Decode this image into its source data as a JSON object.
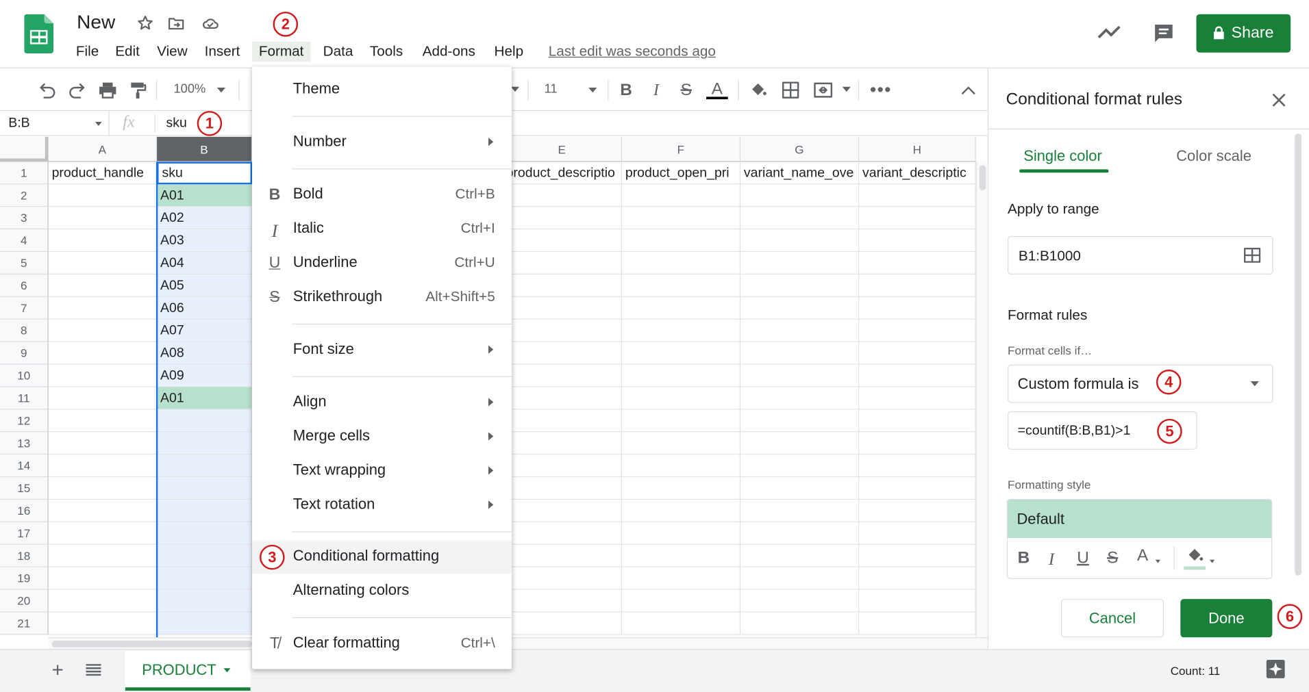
{
  "app": {
    "title": "New",
    "last_edit": "Last edit was seconds ago",
    "share_label": "Share",
    "brand_color": "#188038"
  },
  "menubar": [
    "File",
    "Edit",
    "View",
    "Insert",
    "Format",
    "Data",
    "Tools",
    "Add-ons",
    "Help"
  ],
  "toolbar": {
    "zoom": "100%",
    "font_size": "11"
  },
  "formula_bar": {
    "name_box": "B:B",
    "fx": "fx",
    "content": "sku"
  },
  "grid": {
    "columns": [
      "A",
      "B",
      "E",
      "F",
      "G",
      "H"
    ],
    "row_numbers": [
      "1",
      "2",
      "3",
      "4",
      "5",
      "6",
      "7",
      "8",
      "9",
      "10",
      "11",
      "12",
      "13",
      "14",
      "15",
      "16",
      "17",
      "18",
      "19",
      "20",
      "21"
    ],
    "row1": {
      "A": "product_handle",
      "B": "sku",
      "E": "product_descriptio",
      "F": "product_open_pri",
      "G": "variant_name_ove",
      "H": "variant_descriptic"
    },
    "b_values": [
      "A01",
      "A02",
      "A03",
      "A04",
      "A05",
      "A06",
      "A07",
      "A08",
      "A09",
      "A01"
    ]
  },
  "format_menu": {
    "theme": "Theme",
    "number": "Number",
    "bold": "Bold",
    "bold_sc": "Ctrl+B",
    "italic": "Italic",
    "italic_sc": "Ctrl+I",
    "underline": "Underline",
    "underline_sc": "Ctrl+U",
    "strike": "Strikethrough",
    "strike_sc": "Alt+Shift+5",
    "font_size": "Font size",
    "align": "Align",
    "merge": "Merge cells",
    "wrap": "Text wrapping",
    "rotation": "Text rotation",
    "conditional": "Conditional formatting",
    "alternating": "Alternating colors",
    "clear": "Clear formatting",
    "clear_sc": "Ctrl+\\"
  },
  "panel": {
    "title": "Conditional format rules",
    "tab_single": "Single color",
    "tab_scale": "Color scale",
    "apply_label": "Apply to range",
    "range": "B1:B1000",
    "rules_label": "Format rules",
    "cells_if": "Format cells if…",
    "condition": "Custom formula is",
    "formula": "=countif(B:B,B1)>1",
    "style_label": "Formatting style",
    "style_default": "Default",
    "cancel": "Cancel",
    "done": "Done"
  },
  "badges": [
    "1",
    "2",
    "3",
    "4",
    "5",
    "6"
  ],
  "sheet": {
    "tab": "PRODUCT",
    "count": "Count: 11"
  }
}
